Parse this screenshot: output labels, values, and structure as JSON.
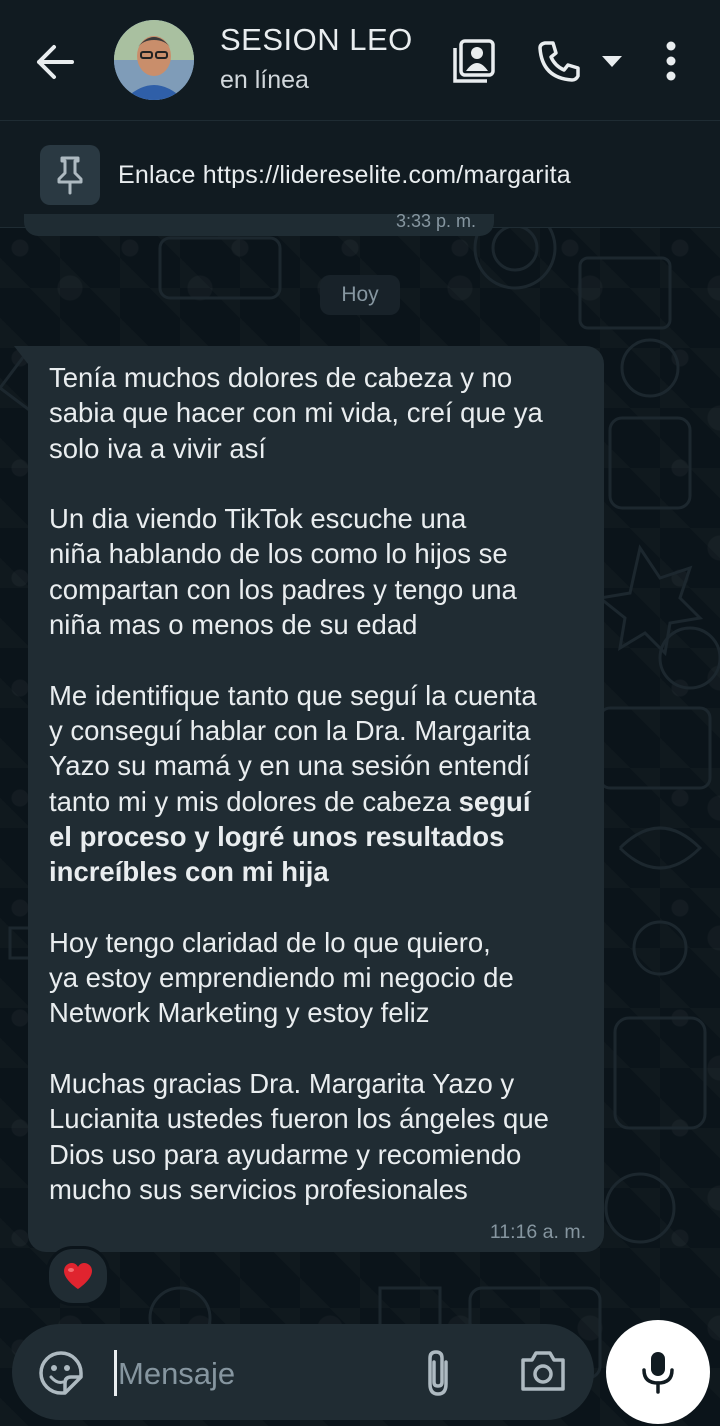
{
  "header": {
    "contact_name": "SESION LEO",
    "status": "en línea",
    "icons": [
      "back-arrow-icon",
      "contacts-icon",
      "phone-icon",
      "dropdown-caret-icon",
      "more-vert-icon"
    ]
  },
  "pinned": {
    "icon": "pin-icon",
    "text": "Enlace https://lidereselite.com/margarita"
  },
  "chat": {
    "previous_time": "3:33 p. m.",
    "date_chip": "Hoy",
    "message": {
      "para1": "Tenía muchos dolores de cabeza y no\nsabia que hacer con mi vida, creí que ya\nsolo iva a vivir así",
      "para2": "Un dia viendo TikTok escuche una\nniña hablando de los como lo hijos se\ncompartan con los padres y tengo una\nniña mas o menos de su edad",
      "para3_plain": "Me identifique tanto que seguí la cuenta\ny conseguí hablar con la Dra. Margarita\nYazo su mamá y en una sesión entendí\ntanto mi y mis dolores de cabeza ",
      "para3_bold": "seguí\nel proceso y logré unos resultados\nincreíbles con mi hija",
      "para4": "Hoy tengo claridad de lo que quiero,\nya estoy emprendiendo mi negocio de\nNetwork Marketing y estoy feliz",
      "para5": "Muchas gracias Dra. Margarita Yazo y\nLucianita ustedes fueron los ángeles que\nDios uso para ayudarme y recomiendo\nmucho sus servicios profesionales",
      "time": "11:16 a. m.",
      "reaction": "❤️"
    }
  },
  "composer": {
    "placeholder": "Mensaje",
    "icons": [
      "sticker-emoji-icon",
      "paperclip-icon",
      "camera-icon",
      "microphone-icon"
    ]
  },
  "colors": {
    "background": "#0b141a",
    "header": "#111b21",
    "bubble": "#202c33",
    "text": "#e9edef",
    "muted": "#8696a0",
    "heart": "#e0242f"
  }
}
